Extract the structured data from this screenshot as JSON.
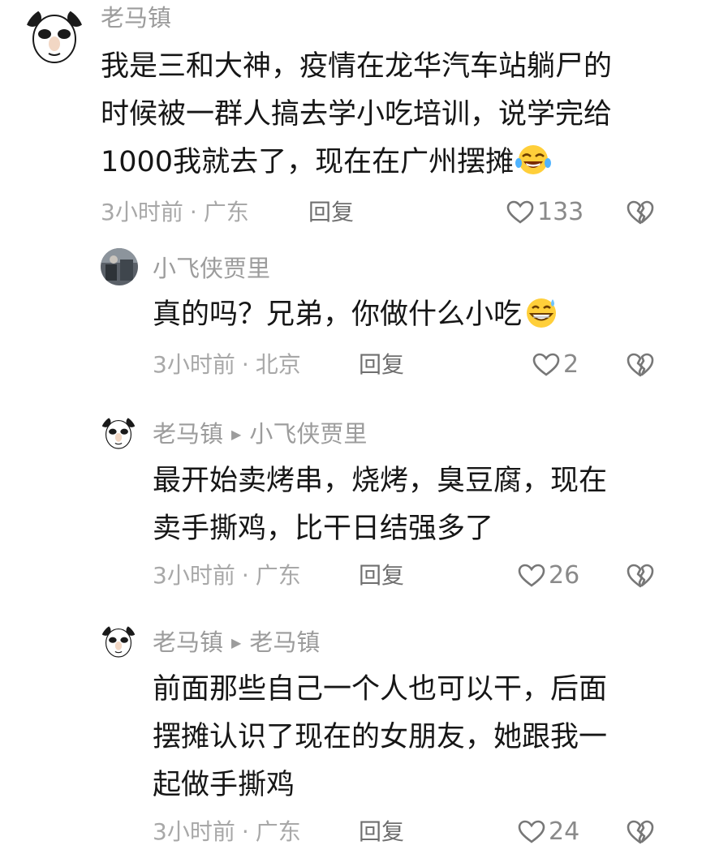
{
  "comments": [
    {
      "author": "老马镇",
      "reply_to": "",
      "lines": [
        "我是三和大神，疫情在龙华汽车站躺尸的",
        "时候被一群人搞去学小吃培训，说学完给",
        "1000我就去了，现在在广州摆摊"
      ],
      "emoji": "laughing-emoji",
      "time": "3小时前",
      "location": "广东",
      "reply_label": "回复",
      "likes": "133"
    },
    {
      "author": "小飞侠贾里",
      "reply_to": "",
      "lines": [
        "真的吗？兄弟，你做什么小吃"
      ],
      "emoji": "grinning-sweat-emoji",
      "time": "3小时前",
      "location": "北京",
      "reply_label": "回复",
      "likes": "2"
    },
    {
      "author": "老马镇",
      "reply_to": "小飞侠贾里",
      "lines": [
        "最开始卖烤串，烧烤，臭豆腐，现在",
        "卖手撕鸡，比干日结强多了"
      ],
      "time": "3小时前",
      "location": "广东",
      "reply_label": "回复",
      "likes": "26"
    },
    {
      "author": "老马镇",
      "reply_to": "老马镇",
      "lines": [
        "前面那些自己一个人也可以干，后面",
        "摆摊认识了现在的女朋友，她跟我一",
        "起做手撕鸡"
      ],
      "time": "3小时前",
      "location": "广东",
      "reply_label": "回复",
      "likes": "24"
    }
  ],
  "separator": "·",
  "colors": {
    "text": "#161616",
    "meta": "#a8a8a8",
    "name": "#9c9c9c"
  },
  "icons": {
    "like": "heart-outline-icon",
    "dislike": "broken-heart-icon"
  }
}
